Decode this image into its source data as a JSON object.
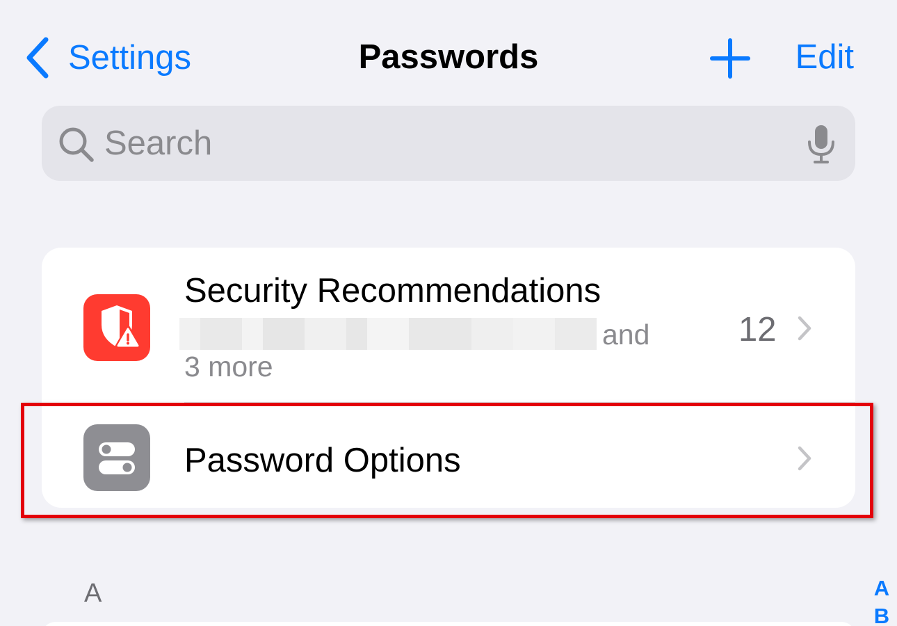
{
  "nav": {
    "back_label": "Settings",
    "title": "Passwords",
    "edit_label": "Edit"
  },
  "search": {
    "placeholder": "Search"
  },
  "rows": {
    "security": {
      "title": "Security Recommendations",
      "subtitle_suffix": "and",
      "subtitle_line2": "3 more",
      "count": "12",
      "icon": "shield-warning-icon"
    },
    "options": {
      "title": "Password Options",
      "icon": "toggles-icon"
    }
  },
  "section_header": "A",
  "index": [
    "A",
    "B"
  ],
  "colors": {
    "accent": "#0a7aff",
    "background": "#f2f2f7",
    "security_icon_bg": "#ff3b30",
    "options_icon_bg": "#8e8e93",
    "highlight": "#e3000b"
  }
}
